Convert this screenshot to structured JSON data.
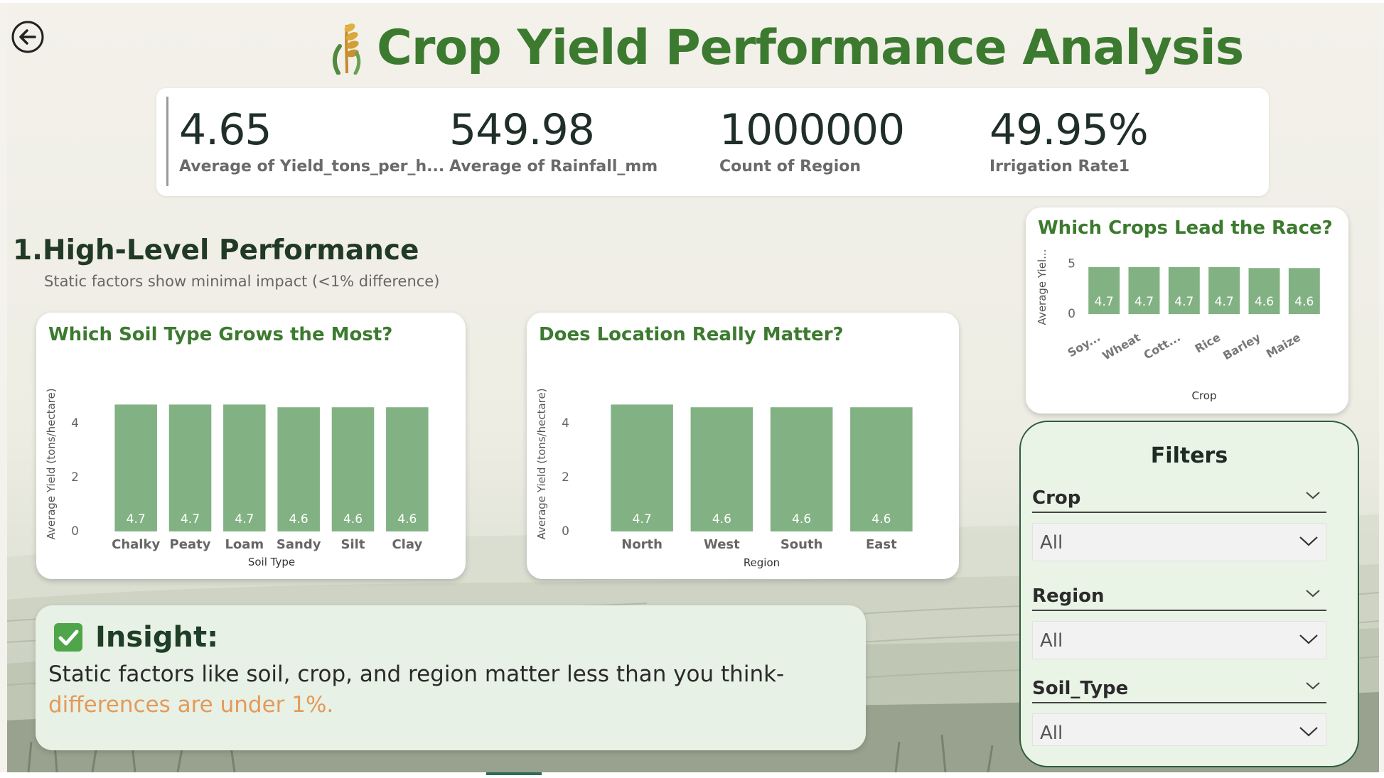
{
  "header": {
    "title": "Crop Yield Performance Analysis",
    "icon": "wheat-icon"
  },
  "nav": {
    "back_icon": "back-arrow-icon"
  },
  "kpis": [
    {
      "value": "4.65",
      "label": "Average of Yield_tons_per_h..."
    },
    {
      "value": "549.98",
      "label": "Average of Rainfall_mm"
    },
    {
      "value": "1000000",
      "label": "Count of Region"
    },
    {
      "value": "49.95%",
      "label": "Irrigation Rate1"
    }
  ],
  "section": {
    "title": "1.High-Level Performance",
    "subtitle": "Static factors show minimal impact (<1% difference)"
  },
  "charts": {
    "soil": {
      "title": "Which Soil Type Grows the Most?"
    },
    "region": {
      "title": "Does Location Really Matter?"
    },
    "crops": {
      "title": "Which Crops Lead the Race?"
    }
  },
  "chart_data": [
    {
      "type": "bar",
      "title": "Which Soil Type Grows the Most?",
      "xlabel": "Soil Type",
      "ylabel": "Average Yield (tons/hectare)",
      "categories": [
        "Chalky",
        "Peaty",
        "Loam",
        "Sandy",
        "Silt",
        "Clay"
      ],
      "values": [
        4.7,
        4.7,
        4.7,
        4.6,
        4.6,
        4.6
      ],
      "data_labels": [
        "4.7",
        "4.7",
        "4.7",
        "4.6",
        "4.6",
        "4.6"
      ],
      "yticks": [
        "0",
        "2",
        "4"
      ],
      "ylim": [
        0,
        5
      ],
      "grid": false
    },
    {
      "type": "bar",
      "title": "Does Location Really Matter?",
      "xlabel": "Region",
      "ylabel": "Average Yield (tons/hectare)",
      "categories": [
        "North",
        "West",
        "South",
        "East"
      ],
      "values": [
        4.7,
        4.6,
        4.6,
        4.6
      ],
      "data_labels": [
        "4.7",
        "4.6",
        "4.6",
        "4.6"
      ],
      "yticks": [
        "0",
        "2",
        "4"
      ],
      "ylim": [
        0,
        5
      ],
      "grid": false
    },
    {
      "type": "bar",
      "title": "Which Crops Lead the Race?",
      "xlabel": "Crop",
      "ylabel": "Average Yiel...",
      "categories": [
        "Soy...",
        "Wheat",
        "Cott...",
        "Rice",
        "Barley",
        "Maize"
      ],
      "values": [
        4.7,
        4.7,
        4.7,
        4.7,
        4.6,
        4.6
      ],
      "data_labels": [
        "4.7",
        "4.7",
        "4.7",
        "4.7",
        "4.6",
        "4.6"
      ],
      "yticks": [
        "0",
        "5"
      ],
      "ylim": [
        0,
        5.4
      ],
      "grid": false
    }
  ],
  "insight": {
    "heading": "Insight:",
    "text": "Static factors like soil, crop, and region matter less than you think-",
    "highlight": "differences are under 1%."
  },
  "filters": {
    "title": "Filters",
    "groups": [
      {
        "label": "Crop",
        "value": "All"
      },
      {
        "label": "Region",
        "value": "All"
      },
      {
        "label": "Soil_Type",
        "value": "All"
      }
    ]
  },
  "colors": {
    "title_green": "#3c7a2f",
    "bar_fill": "#82b283",
    "highlight_orange": "#e39a5a",
    "panel_green": "#e8f1e5"
  }
}
